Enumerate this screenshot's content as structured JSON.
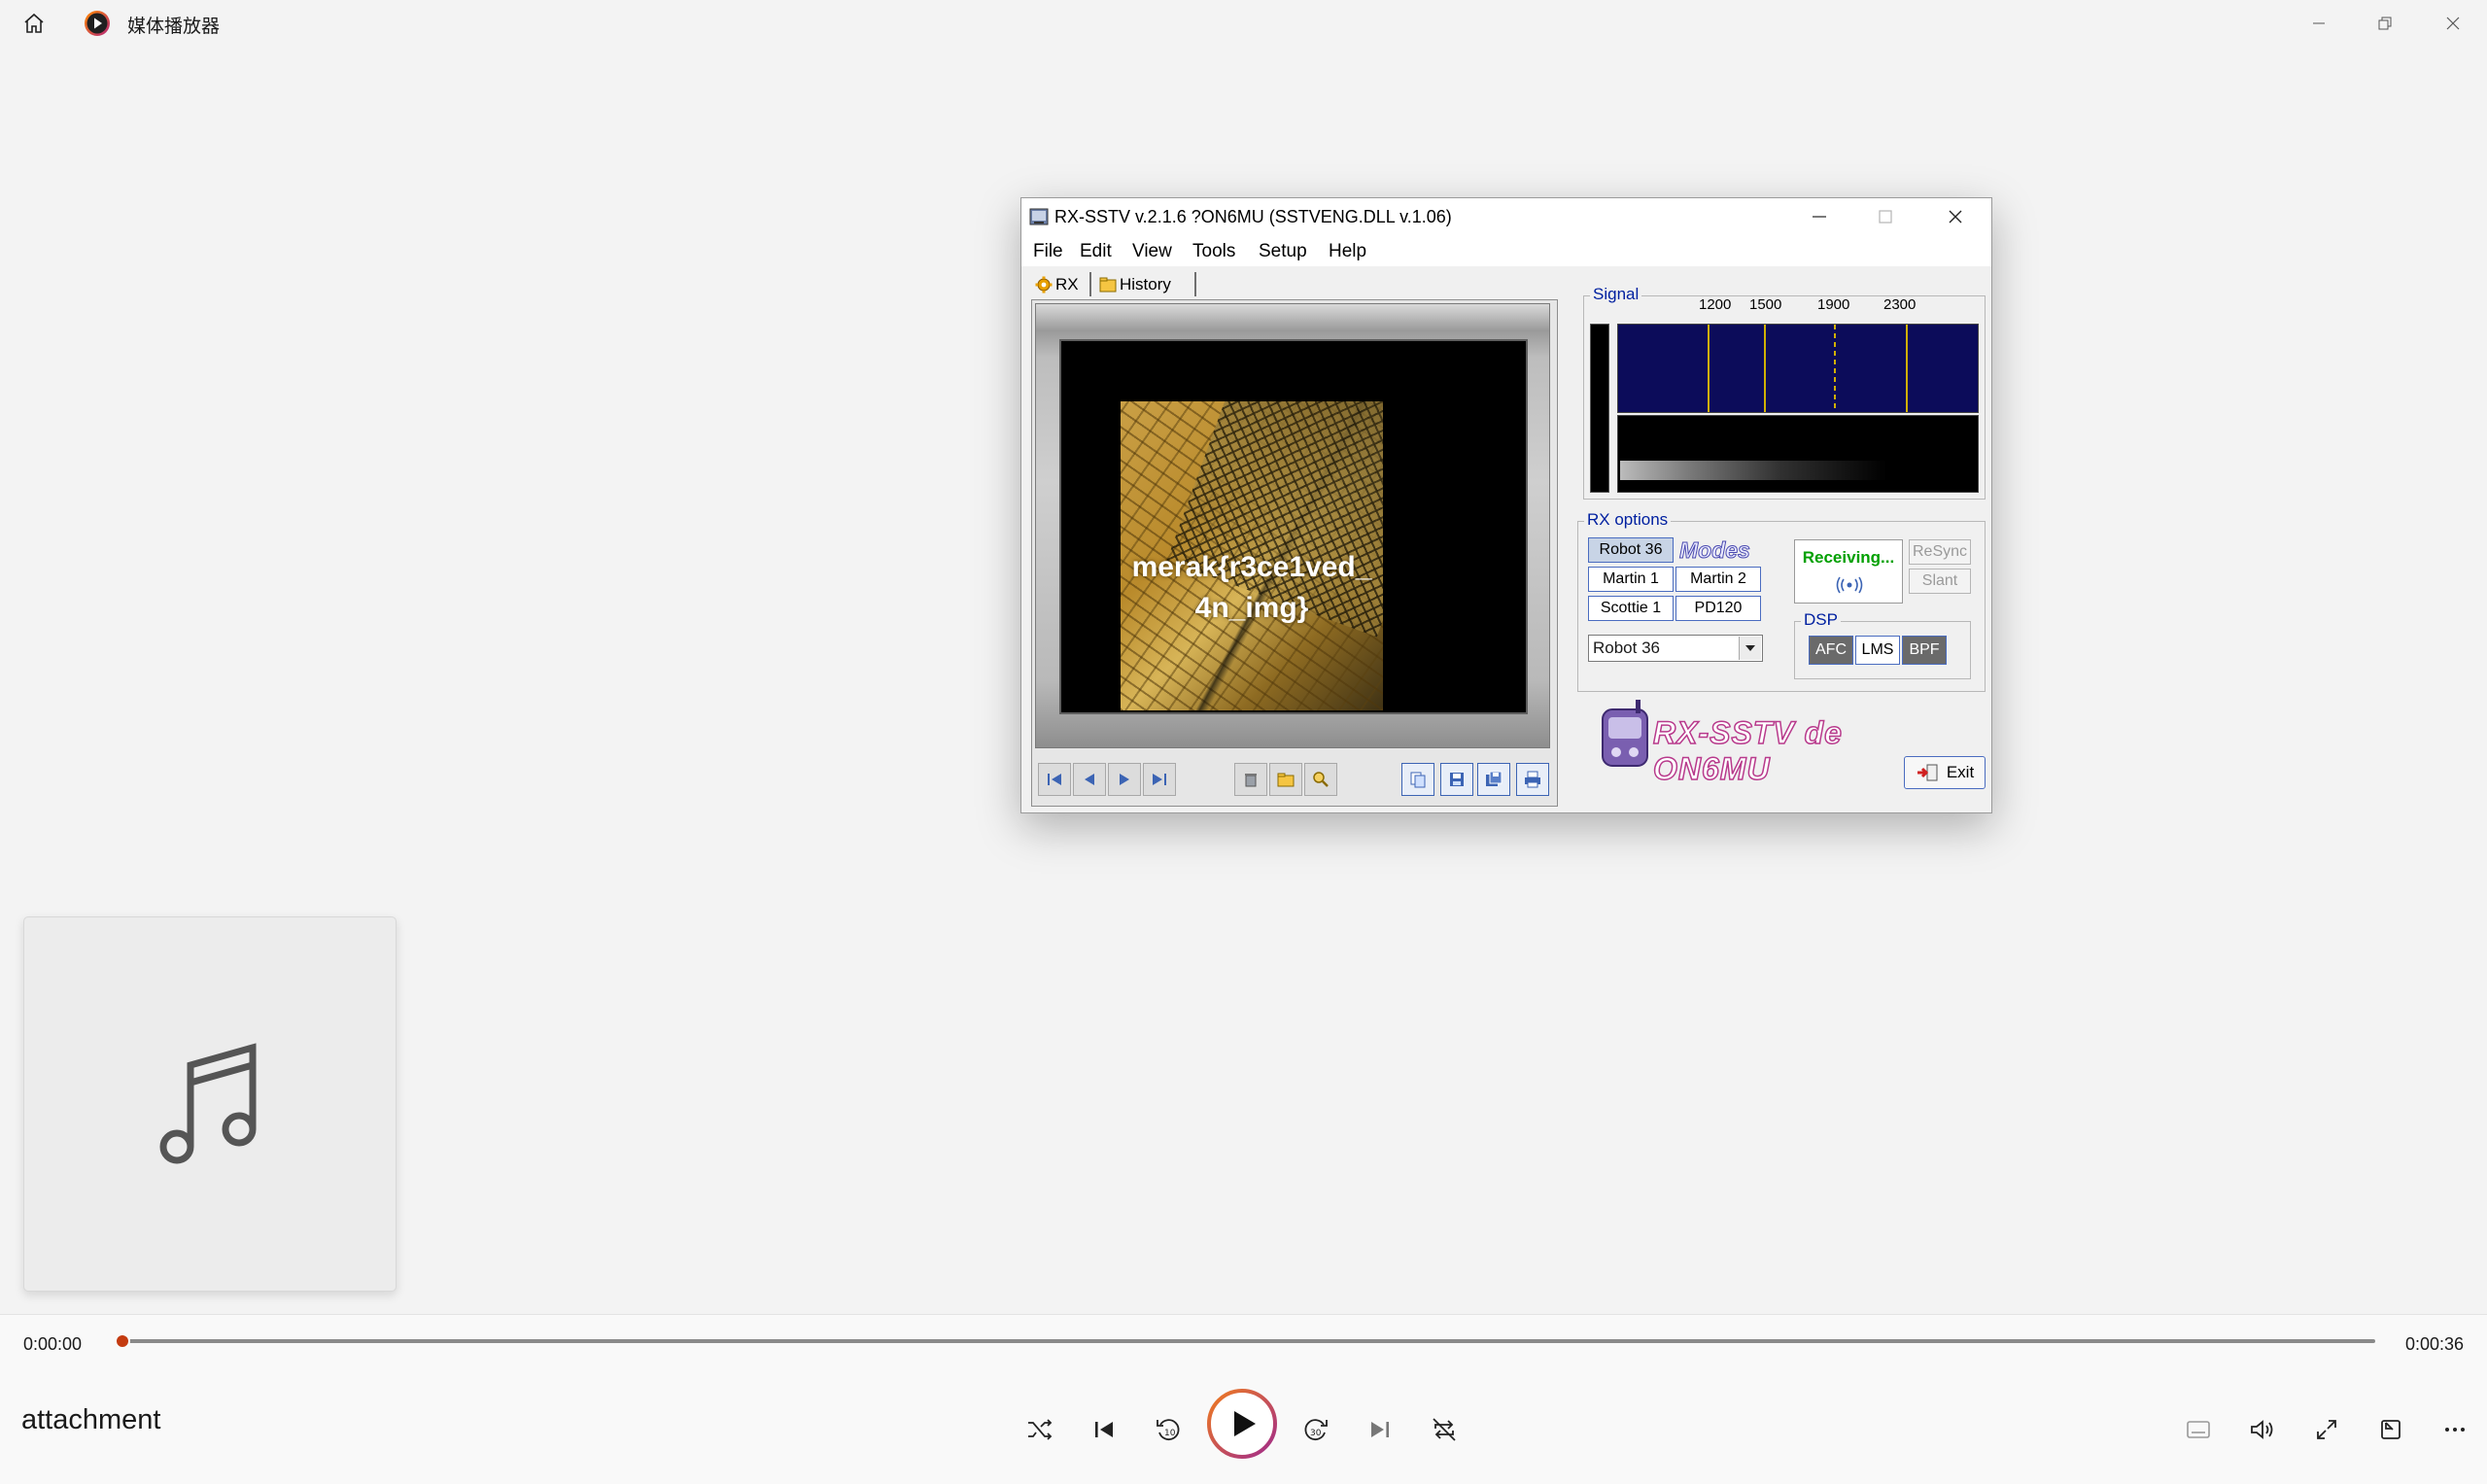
{
  "app": {
    "title": "媒体播放器"
  },
  "window": {
    "title": "RX-SSTV v.2.1.6 ?ON6MU (SSTVENG.DLL v.1.06)",
    "menu": [
      "File",
      "Edit",
      "View",
      "Tools",
      "Setup",
      "Help"
    ],
    "tabs": [
      "RX",
      "History"
    ]
  },
  "received_image": {
    "text_line1": "merak{r3ce1ved_",
    "text_line2": "4n_img}"
  },
  "signal": {
    "label": "Signal",
    "freq_labels": [
      "1200",
      "1500",
      "1900",
      "2300"
    ]
  },
  "rx_options": {
    "label": "RX options",
    "modes": [
      "Robot 36",
      "Martin 1",
      "Martin 2",
      "Scottie 1",
      "PD120"
    ],
    "active_mode": "Robot 36",
    "modes_logo": "Modes",
    "select_value": "Robot 36",
    "status": "Receiving...",
    "resync": "ReSync",
    "slant": "Slant",
    "dsp_label": "DSP",
    "dsp": [
      "AFC",
      "LMS",
      "BPF"
    ]
  },
  "logo_text": "RX-SSTV de ON6MU",
  "exit_label": "Exit",
  "player": {
    "current_time": "0:00:00",
    "total_time": "0:00:36",
    "track_title": "attachment",
    "progress": 0
  },
  "colors": {
    "accent": "#c43b10",
    "status_green": "#00a000"
  }
}
